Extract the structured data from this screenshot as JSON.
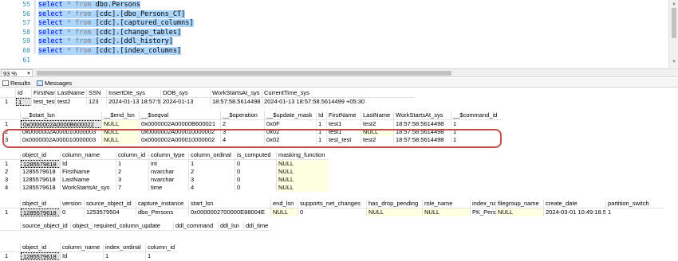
{
  "editor": {
    "lines": [
      {
        "num": "55",
        "keyword": "select",
        "rest": " * from ",
        "target": "dbo.Persons"
      },
      {
        "num": "56",
        "keyword": "select",
        "rest": " * from ",
        "target": "[cdc].[dbo_Persons_CT]"
      },
      {
        "num": "57",
        "keyword": "select",
        "rest": " * from ",
        "target": "[cdc].[captured_columns]"
      },
      {
        "num": "58",
        "keyword": "select",
        "rest": " * from ",
        "target": "[cdc].[change_tables]"
      },
      {
        "num": "59",
        "keyword": "select",
        "rest": " * from ",
        "target": "[cdc].[ddl_history]"
      },
      {
        "num": "60",
        "keyword": "select",
        "rest": " * from ",
        "target": "[cdc].[index_columns]"
      },
      {
        "num": "61",
        "keyword": "",
        "rest": "",
        "target": ""
      }
    ],
    "zoom": "93 %"
  },
  "tabs": {
    "results": "Results",
    "messages": "Messages"
  },
  "grid1": {
    "columns": [
      "Id",
      "FirstName",
      "LastName",
      "SSN",
      "InsertDte_sys",
      "DOB_sys",
      "WorkStartsAt_sys",
      "CurrentTime_sys"
    ],
    "rows": [
      {
        "num": "1",
        "cells": [
          "1",
          "test_test",
          "test2",
          "123",
          "2024-01-13 18:57:58.5614420",
          "2024-01-13",
          "18:57:58.5614498",
          "2024-01-13 18:57:58.5614499 +05:30"
        ]
      }
    ]
  },
  "grid2": {
    "columns": [
      "__$start_lsn",
      "__$end_lsn",
      "__$seqval",
      "__$operation",
      "__$update_mask",
      "Id",
      "FirstName",
      "LastName",
      "WorkStartsAt_sys",
      "__$command_id"
    ],
    "rows": [
      {
        "num": "1",
        "cells": [
          "0x0000002A0000B600022",
          "NULL",
          "0x0000002A00000B600021",
          "2",
          "0x0F",
          "1",
          "test1",
          "test2",
          "18:57:58.5614498",
          "1"
        ]
      },
      {
        "num": "2",
        "cells": [
          "0x0000002A000010000003",
          "NULL",
          "0x0000002A000010000002",
          "3",
          "0x02",
          "1",
          "test1",
          "NULL",
          "18:57:58.5614498",
          "1"
        ]
      },
      {
        "num": "3",
        "cells": [
          "0x0000002A000010000003",
          "NULL",
          "0x0000002A000010000002",
          "4",
          "0x02",
          "1",
          "test_test",
          "test2",
          "18:57:58.5614498",
          "1"
        ]
      }
    ]
  },
  "grid3": {
    "columns": [
      "object_id",
      "column_name",
      "column_id",
      "column_type",
      "column_ordinal",
      "is_computed",
      "masking_function"
    ],
    "rows": [
      {
        "num": "1",
        "cells": [
          "1285579618",
          "Id",
          "1",
          "int",
          "1",
          "0",
          "NULL"
        ]
      },
      {
        "num": "2",
        "cells": [
          "1285579618",
          "FirstName",
          "2",
          "nvarchar",
          "2",
          "0",
          "NULL"
        ]
      },
      {
        "num": "3",
        "cells": [
          "1285579618",
          "LastName",
          "3",
          "nvarchar",
          "3",
          "0",
          "NULL"
        ]
      },
      {
        "num": "4",
        "cells": [
          "1285579618",
          "WorkStartsAt_sys",
          "7",
          "time",
          "4",
          "0",
          "NULL"
        ]
      }
    ]
  },
  "grid4": {
    "columns": [
      "object_id",
      "version",
      "source_object_id",
      "capture_instance",
      "start_lsn",
      "end_lsn",
      "supports_net_changes",
      "has_drop_pending",
      "role_name",
      "index_name",
      "filegroup_name",
      "create_date",
      "partition_switch"
    ],
    "rows": [
      {
        "num": "1",
        "cells": [
          "1285579618",
          "0",
          "1253579504",
          "dbo_Persons",
          "0x0000002700000E88004E",
          "NULL",
          "0",
          "NULL",
          "NULL",
          "PK_Persons",
          "NULL",
          "2024-03-01 10:49:18.527",
          "1"
        ]
      }
    ]
  },
  "grid5": {
    "columns": [
      "source_object_id",
      "object_id",
      "required_column_update",
      "ddl_command",
      "ddl_lsn",
      "ddl_time"
    ]
  },
  "grid6": {
    "columns": [
      "object_id",
      "column_name",
      "index_ordinal",
      "column_id"
    ],
    "rows": [
      {
        "num": "1",
        "cells": [
          "1285579618",
          "Id",
          "1",
          "1"
        ]
      }
    ]
  },
  "colors": {
    "selection": "#add6ff",
    "keyword": "#0000ff",
    "null_bg": "#ffffe1",
    "oval": "#c0504d"
  }
}
